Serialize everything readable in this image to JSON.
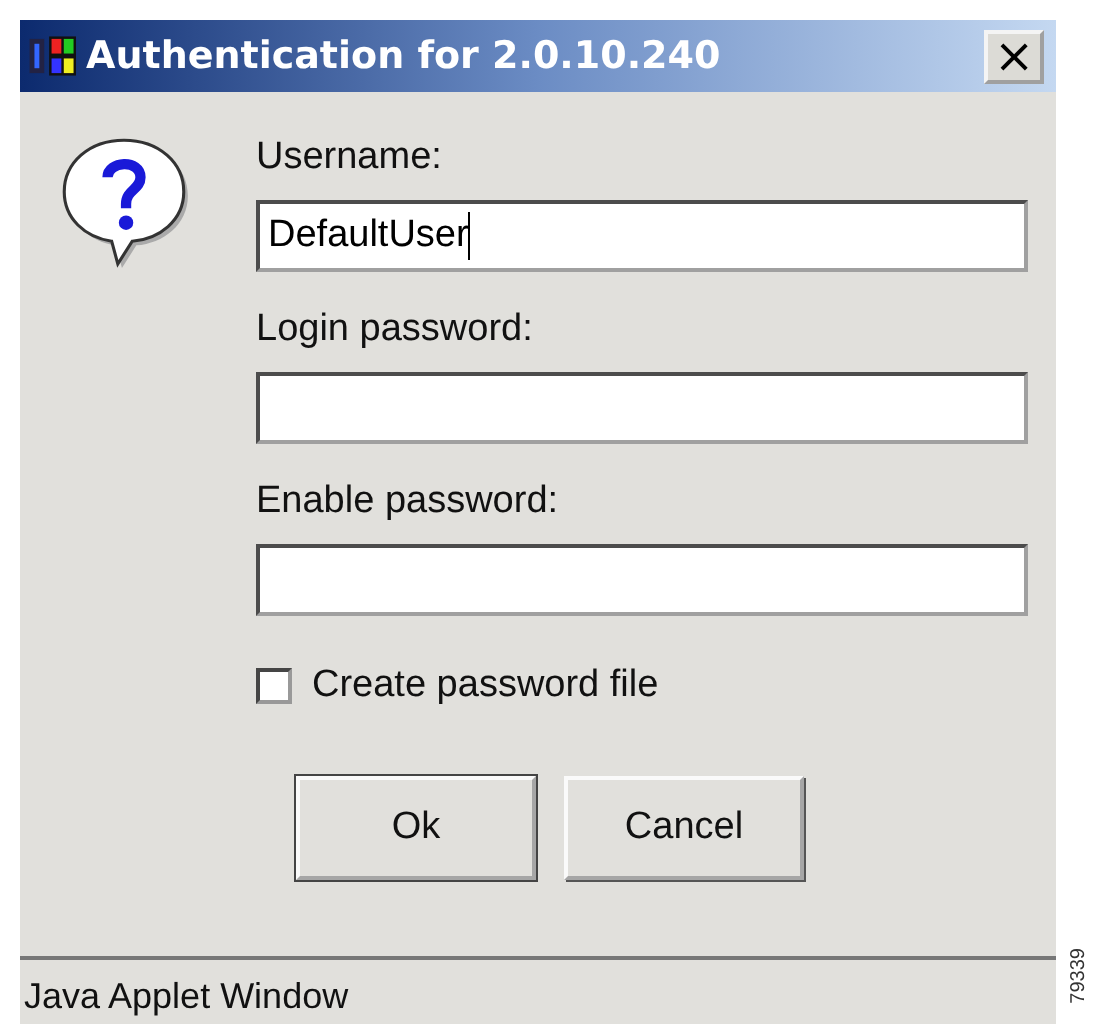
{
  "window": {
    "title": "Authentication for 2.0.10.240",
    "close": "×"
  },
  "fields": [
    {
      "label": "Username:",
      "value": "DefaultUser",
      "focused": true
    },
    {
      "label": "Login password:",
      "focused": false
    },
    {
      "label": "Enable password:",
      "focused": false
    }
  ],
  "checkbox": {
    "label": "Create password file",
    "checked": false
  },
  "buttons": [
    "Ok",
    "Cancel"
  ],
  "status_bar": "Java Applet Window",
  "figure_number": "79339"
}
